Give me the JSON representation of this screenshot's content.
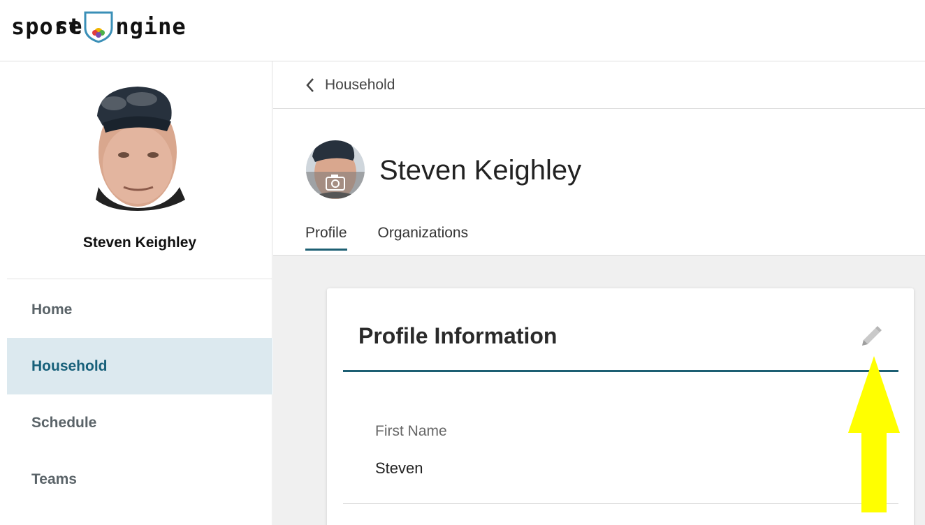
{
  "brand": {
    "logo_text_left": "sport",
    "logo_text_mid": "se",
    "logo_text_right": "ngine"
  },
  "user": {
    "name": "Steven Keighley"
  },
  "sidebar": {
    "items": [
      {
        "label": "Home",
        "active": false
      },
      {
        "label": "Household",
        "active": true
      },
      {
        "label": "Schedule",
        "active": false
      },
      {
        "label": "Teams",
        "active": false
      }
    ]
  },
  "main": {
    "breadcrumb": "Household",
    "tabs": [
      {
        "label": "Profile",
        "active": true
      },
      {
        "label": "Organizations",
        "active": false
      }
    ],
    "card": {
      "title": "Profile Information",
      "fields": [
        {
          "label": "First Name",
          "value": "Steven"
        }
      ]
    }
  },
  "colors": {
    "accent": "#1d5f73",
    "active_nav_bg": "#dce9ef",
    "annotation_arrow": "#ffff00"
  },
  "icons": {
    "back": "chevron-left-icon",
    "edit": "pencil-icon",
    "camera": "camera-icon",
    "annotation": "arrow-up-icon"
  }
}
